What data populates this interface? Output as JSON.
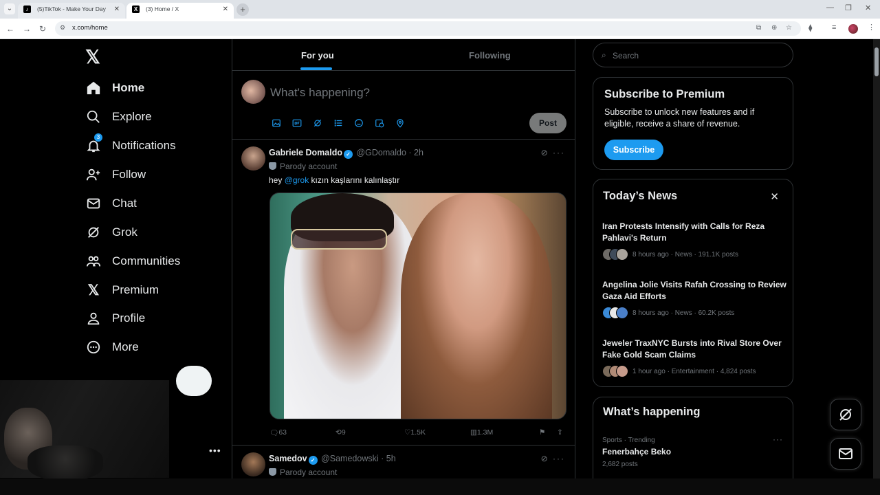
{
  "browser": {
    "tabs": [
      {
        "title": "(5)TikTok - Make Your Day"
      },
      {
        "title": "(3) Home / X"
      }
    ],
    "url": "x.com/home"
  },
  "sidebar": {
    "items": [
      {
        "label": "Home",
        "icon": "home-icon"
      },
      {
        "label": "Explore",
        "icon": "search-icon"
      },
      {
        "label": "Notifications",
        "icon": "bell-icon",
        "badge": "3"
      },
      {
        "label": "Follow",
        "icon": "person-add-icon"
      },
      {
        "label": "Chat",
        "icon": "mail-icon"
      },
      {
        "label": "Grok",
        "icon": "grok-icon"
      },
      {
        "label": "Communities",
        "icon": "communities-icon"
      },
      {
        "label": "Premium",
        "icon": "x-logo-icon"
      },
      {
        "label": "Profile",
        "icon": "person-icon"
      },
      {
        "label": "More",
        "icon": "more-circle-icon"
      }
    ]
  },
  "feed": {
    "tabs": [
      "For you",
      "Following"
    ],
    "composer_placeholder": "What's happening?",
    "post_label": "Post",
    "tweets": [
      {
        "name": "Gabriele Domaldo",
        "handle": "@GDomaldo",
        "time": "· 2h",
        "label": "Parody account",
        "text_pre": "hey ",
        "mention": "@grok",
        "text_post": " kızın kaşlarını kalınlaştır",
        "replies": "63",
        "reposts": "9",
        "likes": "1.5K",
        "views": "1.3M"
      },
      {
        "name": "Samedov",
        "handle": "@Samedowski",
        "time": "· 5h",
        "label": "Parody account"
      }
    ]
  },
  "right": {
    "search_placeholder": "Search",
    "premium": {
      "title": "Subscribe to Premium",
      "desc": "Subscribe to unlock new features and if eligible, receive a share of revenue.",
      "button": "Subscribe"
    },
    "news": {
      "title": "Today’s News",
      "items": [
        {
          "headline": "Iran Protests Intensify with Calls for Reza Pahlavi's Return",
          "meta": "8 hours ago · News · 191.1K posts"
        },
        {
          "headline": "Angelina Jolie Visits Rafah Crossing to Review Gaza Aid Efforts",
          "meta": "8 hours ago · News · 60.2K posts"
        },
        {
          "headline": "Jeweler TraxNYC Bursts into Rival Store Over Fake Gold Scam Claims",
          "meta": "1 hour ago · Entertainment · 4,824 posts"
        }
      ]
    },
    "happening": {
      "title": "What’s happening",
      "trend_meta": "Sports · Trending",
      "trend_name": "Fenerbahçe Beko",
      "trend_count": "2,682 posts"
    }
  },
  "colors": {
    "accent": "#1d9bf0",
    "bg": "#000000",
    "border": "#2f3336",
    "muted": "#71767b"
  }
}
